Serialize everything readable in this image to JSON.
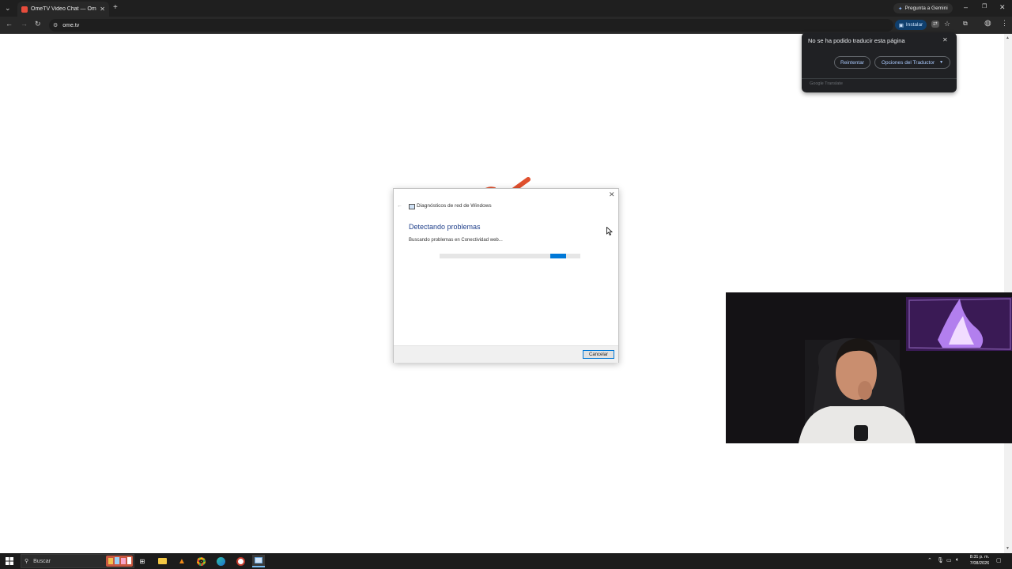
{
  "browser": {
    "tab_title": "OmeTV Video Chat — Omegle",
    "gemini_label": "Pregunta a Gemini",
    "url": "ome.tv",
    "install_label": "Instalar"
  },
  "translate_popup": {
    "message": "No se ha podido traducir esta página",
    "retry_label": "Reintentar",
    "options_label": "Opciones del Traductor",
    "brand": "Google Translate"
  },
  "dialog": {
    "window_title": "Diagnósticos de red de Windows",
    "heading": "Detectando problemas",
    "status": "Buscando problemas en Conectividad web...",
    "cancel_label": "Cancelar",
    "accent_color": "#0078d7"
  },
  "taskbar": {
    "search_placeholder": "Buscar",
    "time": "8:31 p. m.",
    "date": "7/08/2026"
  },
  "colors": {
    "chrome_dark": "#1f1f1f",
    "popup_link": "#a8c7fa",
    "logo_red": "#e0502e"
  }
}
